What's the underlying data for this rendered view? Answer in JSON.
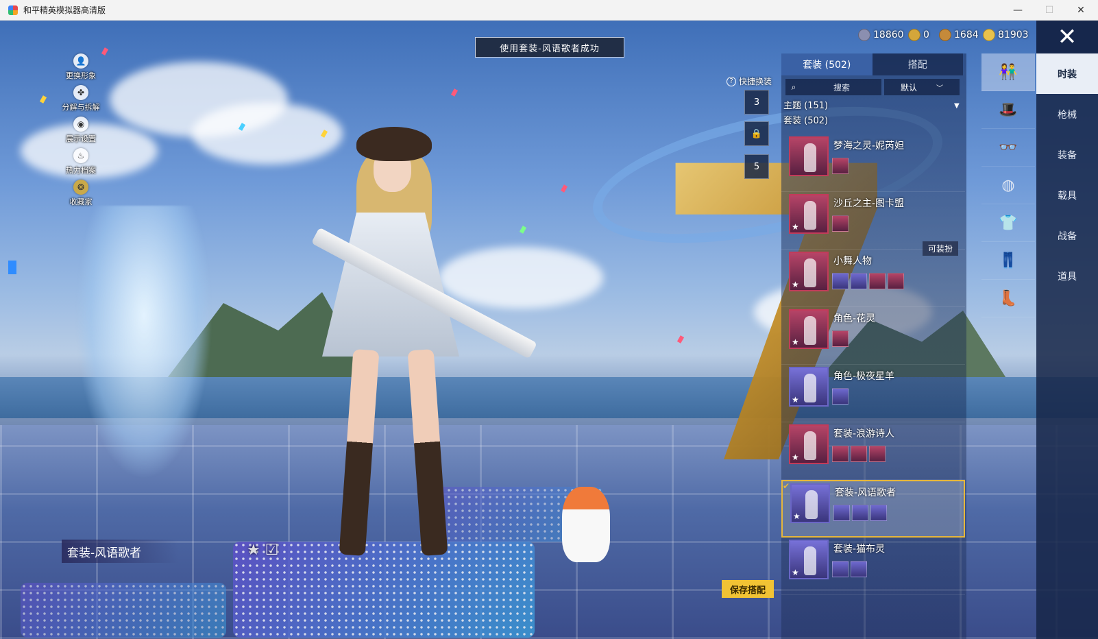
{
  "window": {
    "title": "和平精英模拟器高清版",
    "controls": [
      "—",
      "☐",
      "✕"
    ]
  },
  "toast": "使用套装-风语歌者成功",
  "left_menu": [
    {
      "label": "更换形象",
      "icon": "person-icon",
      "glyph": "👤"
    },
    {
      "label": "分解与拆解",
      "icon": "puzzle-icon",
      "glyph": "✤"
    },
    {
      "label": "展示设置",
      "icon": "eye-icon",
      "glyph": "◉"
    },
    {
      "label": "热力档案",
      "icon": "flame-icon",
      "glyph": "♨"
    },
    {
      "label": "收藏家",
      "icon": "collector-badge-icon",
      "glyph": "❂"
    }
  ],
  "current_suit": "套装-风语歌者",
  "currencies": [
    {
      "value": "18860",
      "color": "#8b8fb0",
      "icon": "gem-icon"
    },
    {
      "value": "0",
      "color": "#d4a63a",
      "icon": "a-coin-icon"
    },
    {
      "value": "1684",
      "color": "#c58a3a",
      "icon": "bronze-coin-icon"
    },
    {
      "value": "81903",
      "color": "#e9c24b",
      "icon": "gold-coin-icon"
    }
  ],
  "close_glyph": "✕",
  "categories": [
    {
      "label": "时装",
      "active": true
    },
    {
      "label": "枪械",
      "active": false
    },
    {
      "label": "装备",
      "active": false
    },
    {
      "label": "载具",
      "active": false
    },
    {
      "label": "战备",
      "active": false
    },
    {
      "label": "道具",
      "active": false
    }
  ],
  "subcategory_icons": [
    {
      "name": "outfit-icon",
      "glyph": "👫",
      "active": true
    },
    {
      "name": "hat-icon",
      "glyph": "🎩",
      "active": false
    },
    {
      "name": "glasses-icon",
      "glyph": "👓",
      "active": false
    },
    {
      "name": "mask-icon",
      "glyph": "◍",
      "active": false
    },
    {
      "name": "top-icon",
      "glyph": "👕",
      "active": false
    },
    {
      "name": "pants-icon",
      "glyph": "👖",
      "active": false
    },
    {
      "name": "shoes-icon",
      "glyph": "👢",
      "active": false
    }
  ],
  "tabs": [
    {
      "label": "套装 (502)",
      "active": true
    },
    {
      "label": "搭配",
      "active": false
    }
  ],
  "search": {
    "placeholder": "搜索"
  },
  "sort": {
    "value": "默认"
  },
  "filters": {
    "theme": "主题 (151)",
    "suits": "套装 (502)"
  },
  "quick_change": {
    "label": "快捷换装",
    "slots": [
      "3",
      "",
      "5"
    ]
  },
  "wearable_badge": "可装扮",
  "outfits": [
    {
      "name": "梦海之灵-妮芮妲",
      "chips": 1,
      "style": "pink",
      "selected": false
    },
    {
      "name": "沙丘之主-图卡盟",
      "chips": 1,
      "style": "pink",
      "selected": false
    },
    {
      "name": "小舞人物",
      "chips": 4,
      "style": "pink",
      "selected": false
    },
    {
      "name": "角色-花灵",
      "chips": 1,
      "style": "pink",
      "selected": false
    },
    {
      "name": "角色-极夜星羊",
      "chips": 1,
      "style": "blue",
      "selected": false
    },
    {
      "name": "套装-浪游诗人",
      "chips": 3,
      "style": "pink",
      "selected": false
    },
    {
      "name": "套装-风语歌者",
      "chips": 3,
      "style": "blue",
      "selected": true
    },
    {
      "name": "套装-猫布灵",
      "chips": 2,
      "style": "blue",
      "selected": false
    }
  ],
  "save_button": "保存搭配",
  "favorite_glyph": "★ ☑"
}
